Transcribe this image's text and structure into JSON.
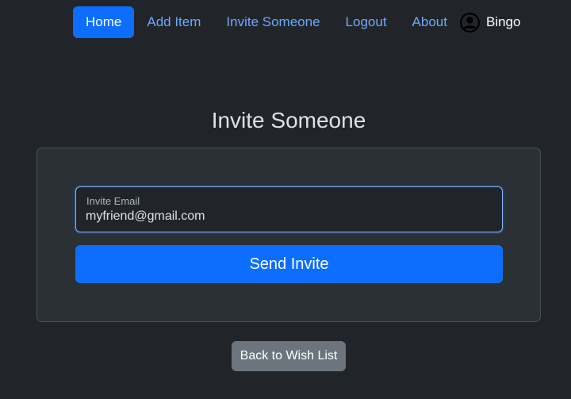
{
  "nav": {
    "items": [
      {
        "label": "Home",
        "active": true
      },
      {
        "label": "Add Item"
      },
      {
        "label": "Invite Someone"
      },
      {
        "label": "Logout"
      },
      {
        "label": "About"
      }
    ],
    "user": {
      "icon": "user-circle-icon",
      "name": "Bingo"
    }
  },
  "main": {
    "title": "Invite Someone",
    "form": {
      "email_label": "Invite Email",
      "email_value": "myfriend@gmail.com",
      "submit_label": "Send Invite"
    },
    "back_label": "Back to Wish List"
  },
  "colors": {
    "background": "#212529",
    "card": "#2b3035",
    "primary": "#0d6efd",
    "link": "#6ea8fe",
    "secondary": "#6c757d"
  }
}
